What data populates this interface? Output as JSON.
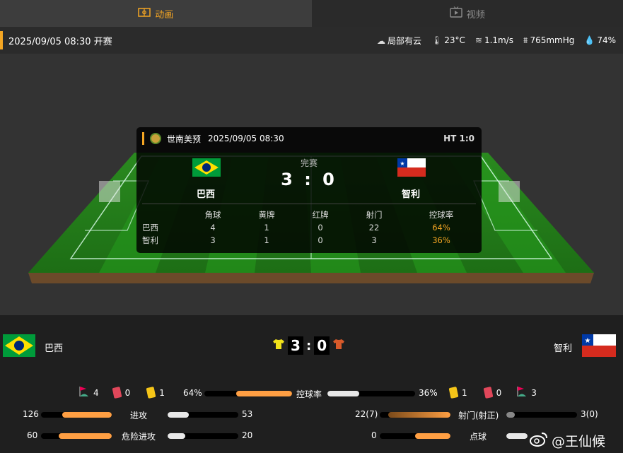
{
  "tabs": [
    {
      "label": "动画",
      "icon": "pitch-icon",
      "active": true
    },
    {
      "label": "视频",
      "icon": "video-icon",
      "active": false
    }
  ],
  "match_info": {
    "datetime": "2025/09/05 08:30 开赛",
    "weather": "局部有云",
    "temperature": "23°C",
    "wind": "1.1m/s",
    "pressure": "765mmHg",
    "humidity": "74%"
  },
  "panel": {
    "competition": "世南美预",
    "datetime": "2025/09/05 08:30",
    "ht": "HT 1:0",
    "status": "完赛",
    "home": "巴西",
    "away": "智利",
    "score": "3 : 0",
    "headers": [
      "角球",
      "黄牌",
      "红牌",
      "射门",
      "控球率"
    ],
    "rows": [
      {
        "team": "巴西",
        "values": [
          "4",
          "1",
          "0",
          "22",
          "64%"
        ]
      },
      {
        "team": "智利",
        "values": [
          "3",
          "1",
          "0",
          "3",
          "36%"
        ]
      }
    ]
  },
  "scoreboard": {
    "home": "巴西",
    "away": "智利",
    "home_score": "3",
    "away_score": "0",
    "colon": ":"
  },
  "summary": {
    "home_corners": "4",
    "home_red": "0",
    "home_yellow": "1",
    "home_possession": "64%",
    "possession_label": "控球率",
    "away_possession": "36%",
    "away_yellow": "1",
    "away_red": "0",
    "away_corners": "3"
  },
  "stats_left": [
    {
      "home": "126",
      "label": "进攻",
      "away": "53",
      "home_frac": 0.7,
      "away_frac": 0.3
    },
    {
      "home": "60",
      "label": "危险进攻",
      "away": "20",
      "home_frac": 0.75,
      "away_frac": 0.25
    }
  ],
  "stats_right": [
    {
      "home": "22(7)",
      "label": "射门(射正)",
      "away": "3(0)",
      "home_frac": 0.88,
      "away_frac": 0.12
    },
    {
      "home": "0",
      "label": "点球",
      "away": "0",
      "home_frac": 0.5,
      "away_frac": 0.5
    }
  ],
  "watermark": "@王仙候",
  "colors": {
    "accent": "#f5a623",
    "home_bar": "#ff9f43",
    "away_bar": "#e8e8e8"
  }
}
